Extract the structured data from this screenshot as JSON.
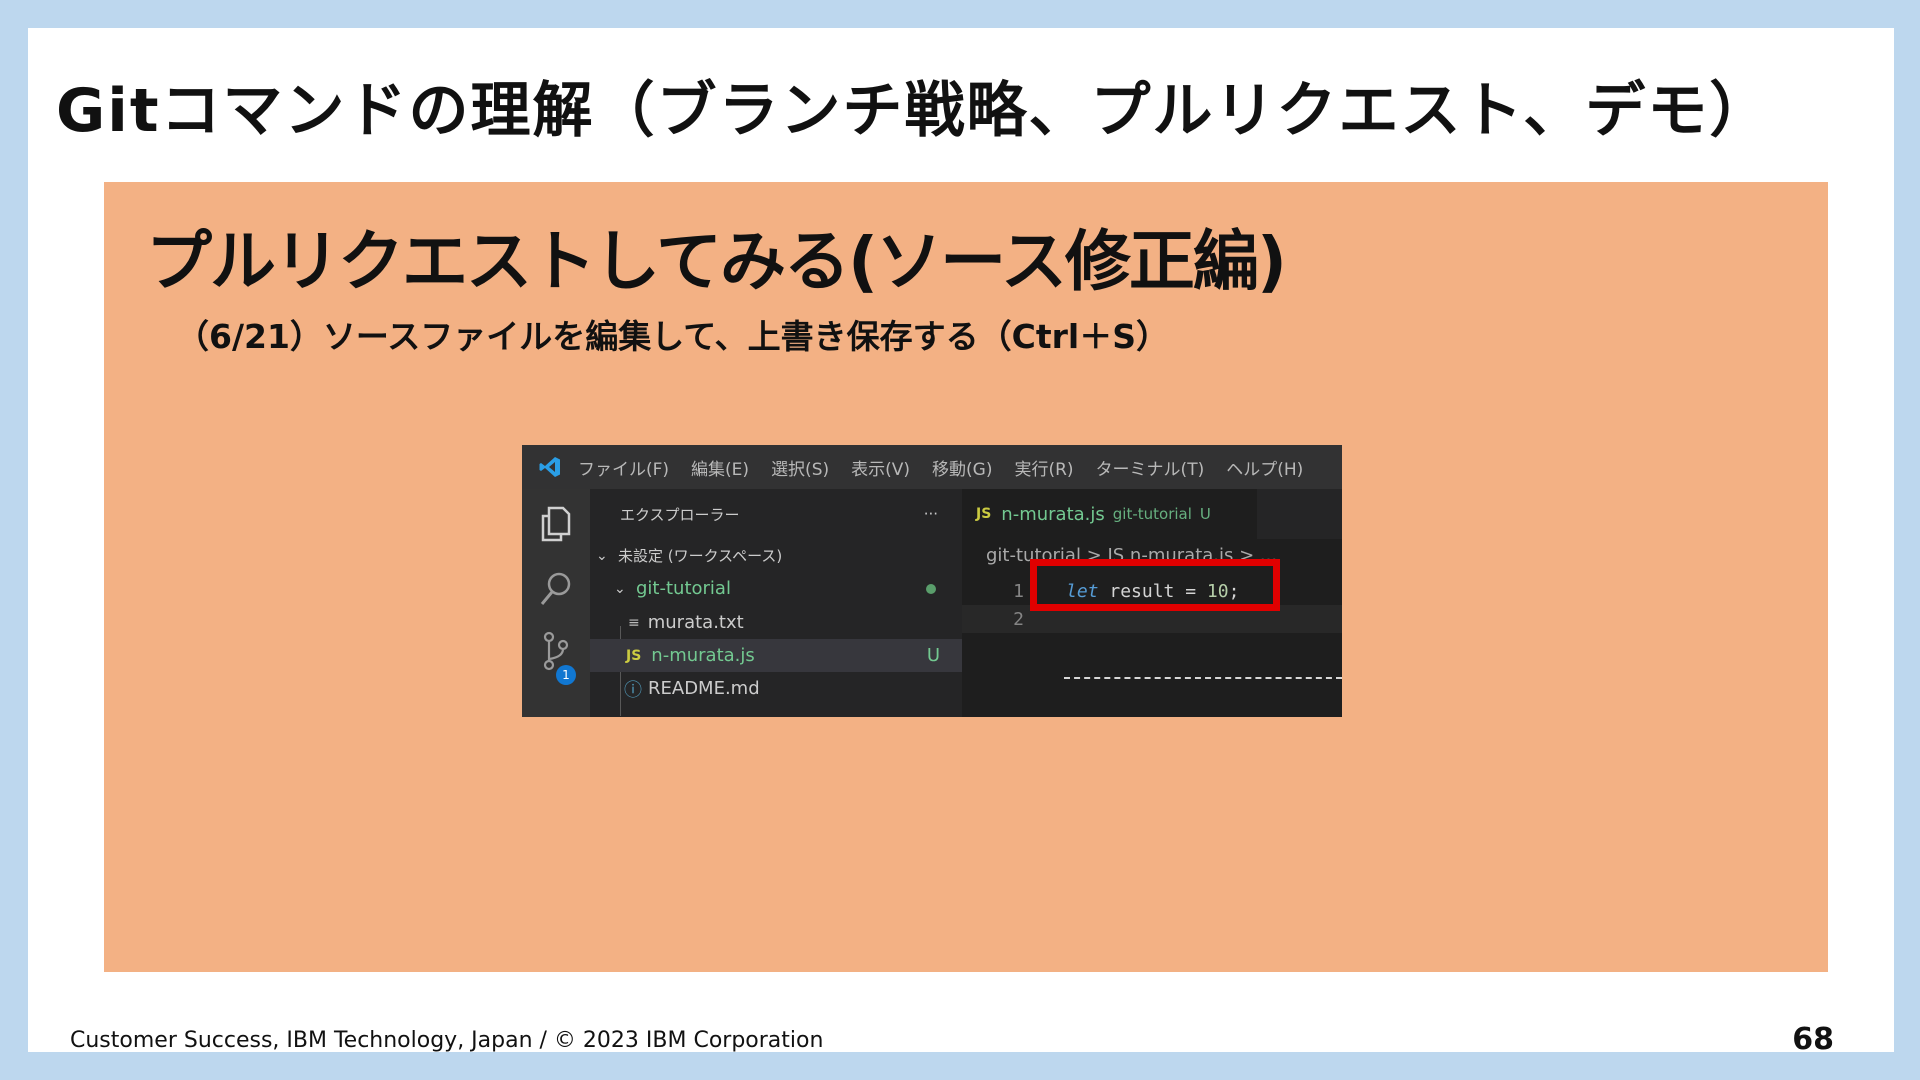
{
  "slide": {
    "title": "Gitコマンドの理解（ブランチ戦略、プルリクエスト、デモ）",
    "heading": "プルリクエストしてみる(ソース修正編)",
    "subheading": "（6/21）ソースファイルを編集して、上書き保存する（Ctrl＋S）",
    "footer": "Customer Success, IBM Technology, Japan / © 2023 IBM Corporation",
    "page_number": "68"
  },
  "vscode": {
    "menu": [
      "ファイル(F)",
      "編集(E)",
      "選択(S)",
      "表示(V)",
      "移動(G)",
      "実行(R)",
      "ターミナル(T)",
      "ヘルプ(H)"
    ],
    "activity_badge": "1",
    "explorer": {
      "title": "エクスプローラー",
      "more": "···",
      "workspace": "未設定 (ワークスペース)",
      "folder": "git-tutorial",
      "files": [
        {
          "icon": "≡",
          "name": "murata.txt",
          "status": ""
        },
        {
          "icon": "JS",
          "name": "n-murata.js",
          "status": "U"
        },
        {
          "icon": "ⓘ",
          "name": "README.md",
          "status": ""
        }
      ]
    },
    "editor": {
      "tab_icon": "JS",
      "tab_name": "n-murata.js",
      "tab_folder": "git-tutorial",
      "tab_status": "U",
      "breadcrumb": "git-tutorial > JS n-murata.js > ...",
      "lines": [
        {
          "number": "1",
          "keyword": "let",
          "variable": "result",
          "operator": "=",
          "value": "10",
          "end": ";"
        },
        {
          "number": "2"
        }
      ]
    },
    "colors": {
      "highlight": "#e00000",
      "background": "#1e1e1e"
    }
  }
}
